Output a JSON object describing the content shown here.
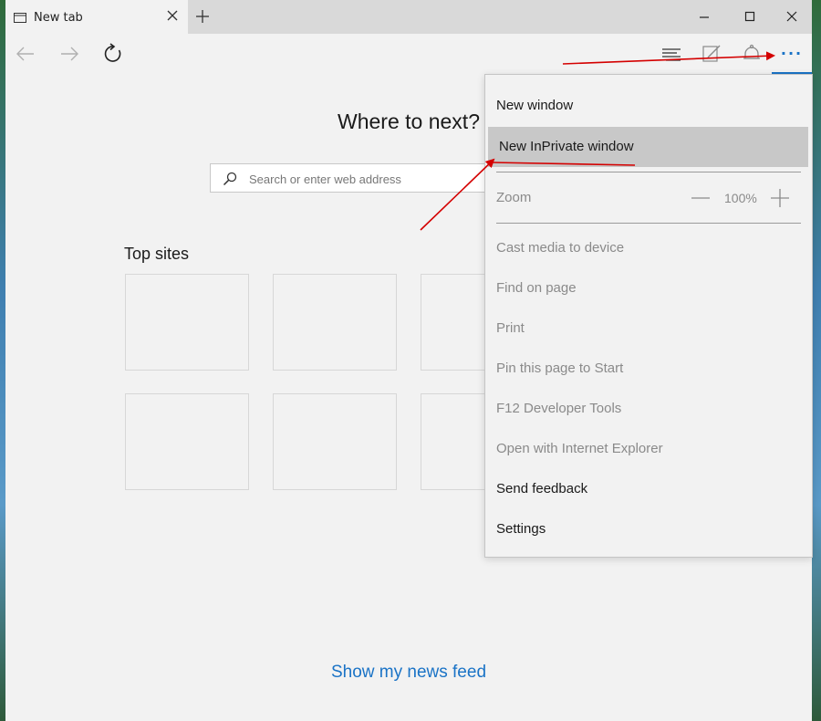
{
  "tab": {
    "title": "New tab"
  },
  "icons": {
    "tab_page": "page-icon",
    "tab_close": "close-icon",
    "new_tab": "plus-icon",
    "minimize": "minimize-icon",
    "maximize": "maximize-icon",
    "close": "close-icon",
    "back": "arrow-left-icon",
    "forward": "arrow-right-icon",
    "refresh": "refresh-icon",
    "hub": "hub-icon",
    "web_note": "pen-icon",
    "share": "notification-icon",
    "more": "more-dots-icon",
    "search": "search-icon"
  },
  "newtab": {
    "heading": "Where to next?",
    "search_placeholder": "Search or enter web address",
    "top_sites_label": "Top sites",
    "news_link": "Show my news feed"
  },
  "menu": {
    "more_label": "···",
    "new_window": "New window",
    "new_inprivate": "New InPrivate window",
    "zoom_label": "Zoom",
    "zoom_value": "100%",
    "cast": "Cast media to device",
    "find": "Find on page",
    "print": "Print",
    "pin": "Pin this page to Start",
    "devtools": "F12 Developer Tools",
    "open_ie": "Open with Internet Explorer",
    "feedback": "Send feedback",
    "settings": "Settings"
  },
  "colors": {
    "accent": "#1a73c6",
    "annotation": "#d40000",
    "menu_hover": "#c8c8c8"
  }
}
